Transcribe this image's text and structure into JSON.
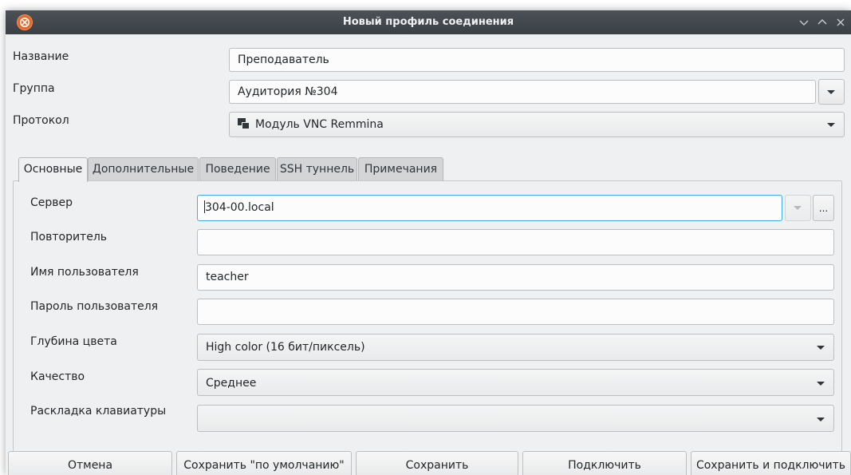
{
  "window": {
    "title": "Новый профиль соединения",
    "app_icon": "remmina-logo-icon"
  },
  "form": {
    "name_label": "Название",
    "name_value": "Преподаватель",
    "group_label": "Группа",
    "group_value": "Аудитория №304",
    "protocol_label": "Протокол",
    "protocol_value": "Модуль VNC Remmina"
  },
  "tabs": [
    {
      "label": "Основные",
      "active": true
    },
    {
      "label": "Дополнительные",
      "active": false
    },
    {
      "label": "Поведение",
      "active": false
    },
    {
      "label": "SSH туннель",
      "active": false
    },
    {
      "label": "Примечания",
      "active": false
    }
  ],
  "basic": {
    "server_label": "Сервер",
    "server_value": "304-00.local",
    "server_browse_label": "...",
    "repeater_label": "Повторитель",
    "repeater_value": "",
    "username_label": "Имя пользователя",
    "username_value": "teacher",
    "password_label": "Пароль пользователя",
    "password_value": "",
    "color_depth_label": "Глубина цвета",
    "color_depth_value": "High color (16 бит/пиксель)",
    "quality_label": "Качество",
    "quality_value": "Среднее",
    "keymap_label": "Раскладка клавиатуры",
    "keymap_value": ""
  },
  "buttons": {
    "cancel": "Отмена",
    "save_default": "Сохранить \"по умолчанию\"",
    "save": "Сохранить",
    "connect": "Подключить",
    "save_connect": "Сохранить и подключить"
  },
  "colors": {
    "titlebar": "#3b4045",
    "window_bg": "#eff0f1",
    "focus_accent": "#3daee9",
    "app_icon": "#e8692b"
  }
}
